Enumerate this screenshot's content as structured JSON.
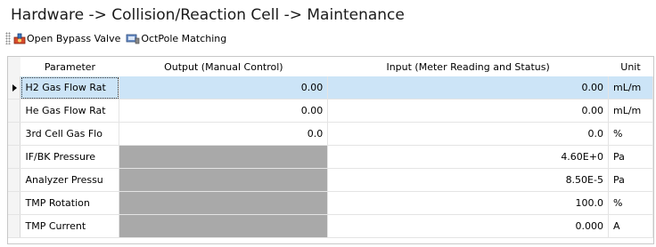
{
  "title": "Hardware -> Collision/Reaction Cell -> Maintenance",
  "toolbar": {
    "open_bypass_label": "Open Bypass Valve",
    "octpole_label": "OctPole Matching"
  },
  "table": {
    "headers": {
      "parameter": "Parameter",
      "output": "Output (Manual Control)",
      "input": "Input (Meter Reading and Status)",
      "unit": "Unit"
    },
    "rows": [
      {
        "parameter": "H2 Gas Flow Rat",
        "output": "0.00",
        "input": "0.00",
        "unit": "mL/m"
      },
      {
        "parameter": "He Gas Flow Rat",
        "output": "0.00",
        "input": "0.00",
        "unit": "mL/m"
      },
      {
        "parameter": "3rd Cell Gas Flo",
        "output": "0.0",
        "input": "0.0",
        "unit": "%"
      },
      {
        "parameter": "IF/BK Pressure",
        "output": "",
        "input": "4.60E+0",
        "unit": "Pa"
      },
      {
        "parameter": "Analyzer Pressu",
        "output": "",
        "input": "8.50E-5",
        "unit": "Pa"
      },
      {
        "parameter": "TMP Rotation",
        "output": "",
        "input": "100.0",
        "unit": "%"
      },
      {
        "parameter": "TMP Current",
        "output": "",
        "input": "0.000",
        "unit": "A"
      }
    ]
  },
  "colors": {
    "selected_row": "#cce4f7",
    "disabled_cell": "#a9a9a9"
  },
  "icons": [
    "grip-icon",
    "bypass-valve-icon",
    "octpole-icon",
    "row-pointer-icon"
  ]
}
